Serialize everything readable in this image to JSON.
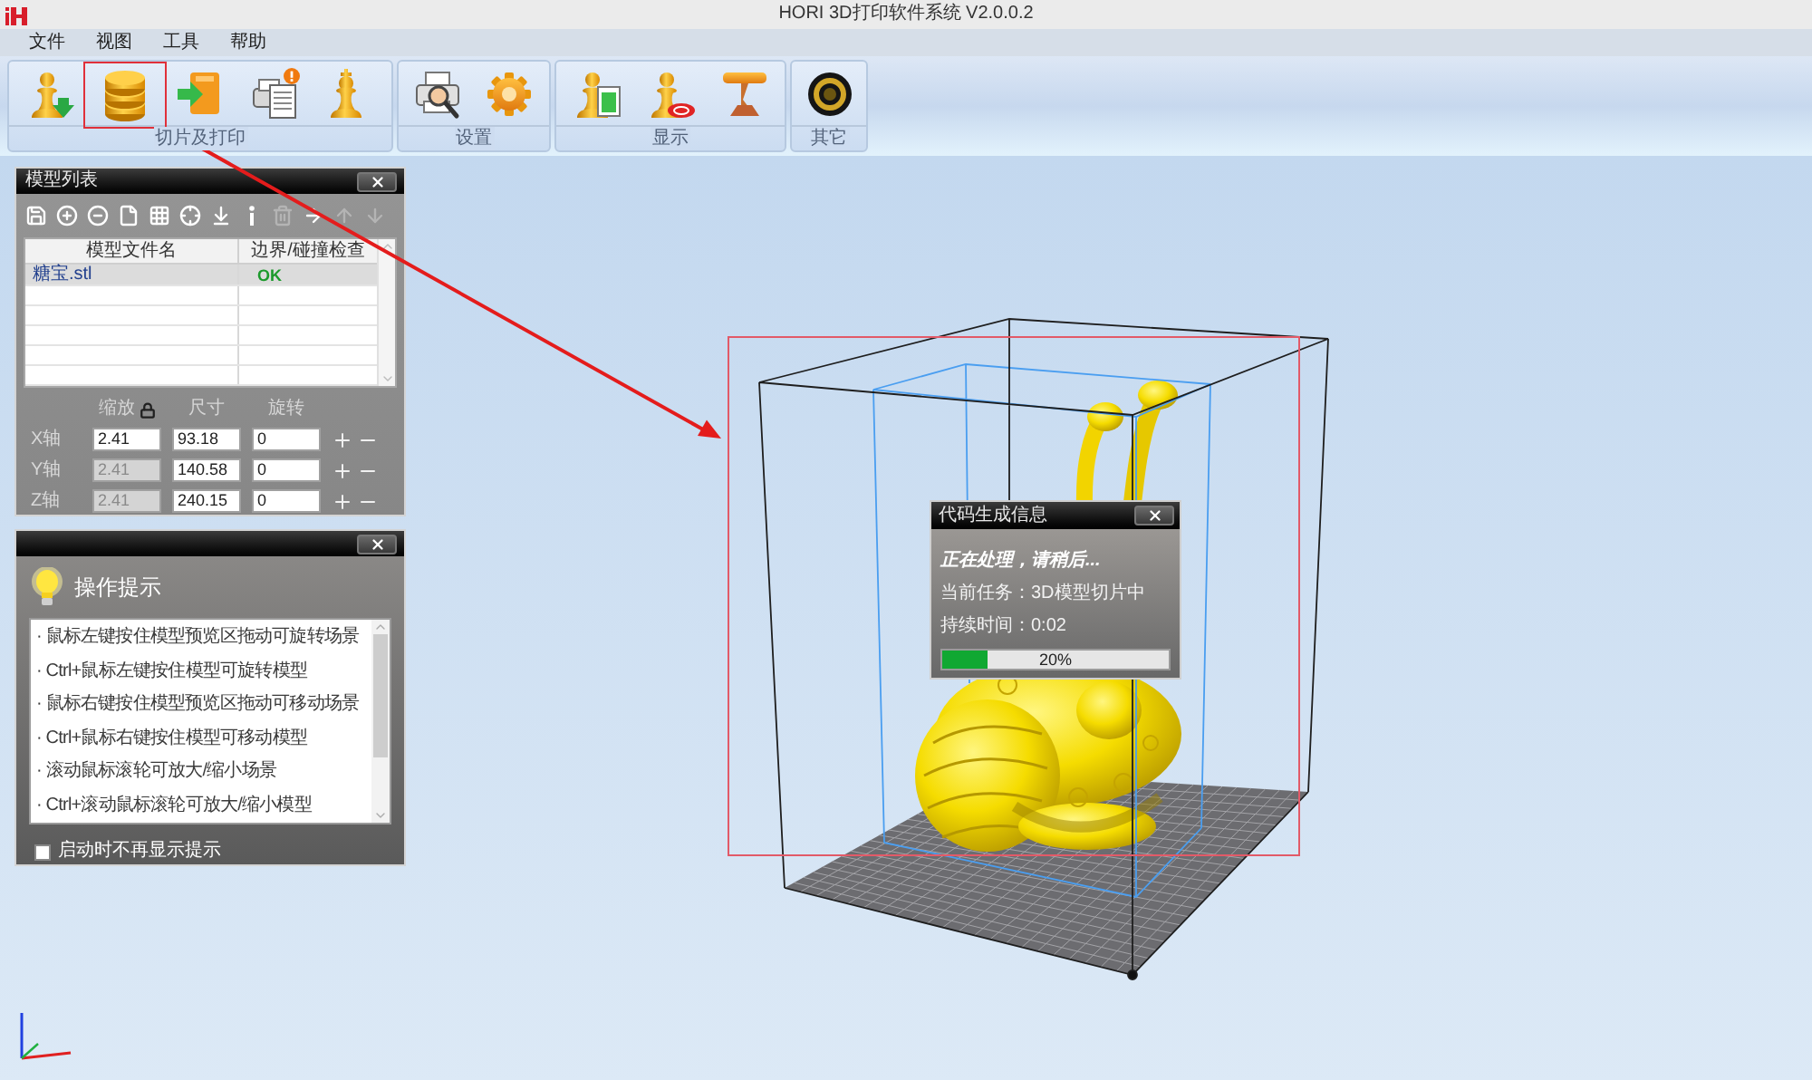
{
  "window": {
    "title": "HORI 3D打印软件系统 V2.0.0.2"
  },
  "menu": [
    "文件",
    "视图",
    "工具",
    "帮助"
  ],
  "toolbar_groups": [
    {
      "label": "切片及打印",
      "buttons": [
        {
          "kind": "load",
          "annotated": false
        },
        {
          "kind": "slice",
          "annotated": true
        },
        {
          "kind": "export",
          "annotated": false
        },
        {
          "kind": "print",
          "annotated": false
        },
        {
          "kind": "piece",
          "annotated": false
        }
      ]
    },
    {
      "label": "设置",
      "buttons": [
        {
          "kind": "printer_setup",
          "annotated": false
        },
        {
          "kind": "gear",
          "annotated": false
        }
      ]
    },
    {
      "label": "显示",
      "buttons": [
        {
          "kind": "piece_doc",
          "annotated": false
        },
        {
          "kind": "piece_target",
          "annotated": false
        },
        {
          "kind": "stand",
          "annotated": false
        }
      ]
    },
    {
      "label": "其它",
      "buttons": [
        {
          "kind": "lens",
          "annotated": false
        }
      ]
    }
  ],
  "model_list": {
    "title": "模型列表",
    "tools": [
      {
        "kind": "save",
        "disabled": false
      },
      {
        "kind": "add",
        "disabled": false
      },
      {
        "kind": "remove",
        "disabled": false
      },
      {
        "kind": "file",
        "disabled": false
      },
      {
        "kind": "grid",
        "disabled": false
      },
      {
        "kind": "center",
        "disabled": false
      },
      {
        "kind": "import",
        "disabled": false
      },
      {
        "kind": "info",
        "disabled": false
      },
      {
        "kind": "delete",
        "disabled": true
      },
      {
        "kind": "move",
        "disabled": false
      },
      {
        "kind": "up",
        "disabled": true
      },
      {
        "kind": "down",
        "disabled": true
      }
    ],
    "table": {
      "columns": [
        "模型文件名",
        "边界/碰撞检查"
      ],
      "rows": [
        {
          "cells": [
            "糖宝.stl",
            "OK"
          ],
          "selected": true
        }
      ]
    },
    "transform": {
      "columns": [
        "缩放",
        "尺寸",
        "旋转"
      ],
      "axes": [
        {
          "label": "X轴",
          "scale": "2.41",
          "scale_disabled": false,
          "size": "93.18",
          "rotation": "0"
        },
        {
          "label": "Y轴",
          "scale": "2.41",
          "scale_disabled": true,
          "size": "140.58",
          "rotation": "0"
        },
        {
          "label": "Z轴",
          "scale": "2.41",
          "scale_disabled": true,
          "size": "240.15",
          "rotation": "0"
        }
      ]
    }
  },
  "tips": {
    "title": "操作提示",
    "items": [
      "· 鼠标左键按住模型预览区拖动可旋转场景",
      "· Ctrl+鼠标左键按住模型可旋转模型",
      "· 鼠标右键按住模型预览区拖动可移动场景",
      "· Ctrl+鼠标右键按住模型可移动模型",
      "· 滚动鼠标滚轮可放大/缩小场景",
      "· Ctrl+滚动鼠标滚轮可放大/缩小模型"
    ],
    "hide_on_startup": {
      "label": "启动时不再显示提示",
      "checked": false
    }
  },
  "progress_dialog": {
    "title": "代码生成信息",
    "status": "正在处理，请稍后...",
    "task": "当前任务：3D模型切片中",
    "elapsed": "持续时间：0:02",
    "level": 0.2,
    "reading": "20%"
  }
}
